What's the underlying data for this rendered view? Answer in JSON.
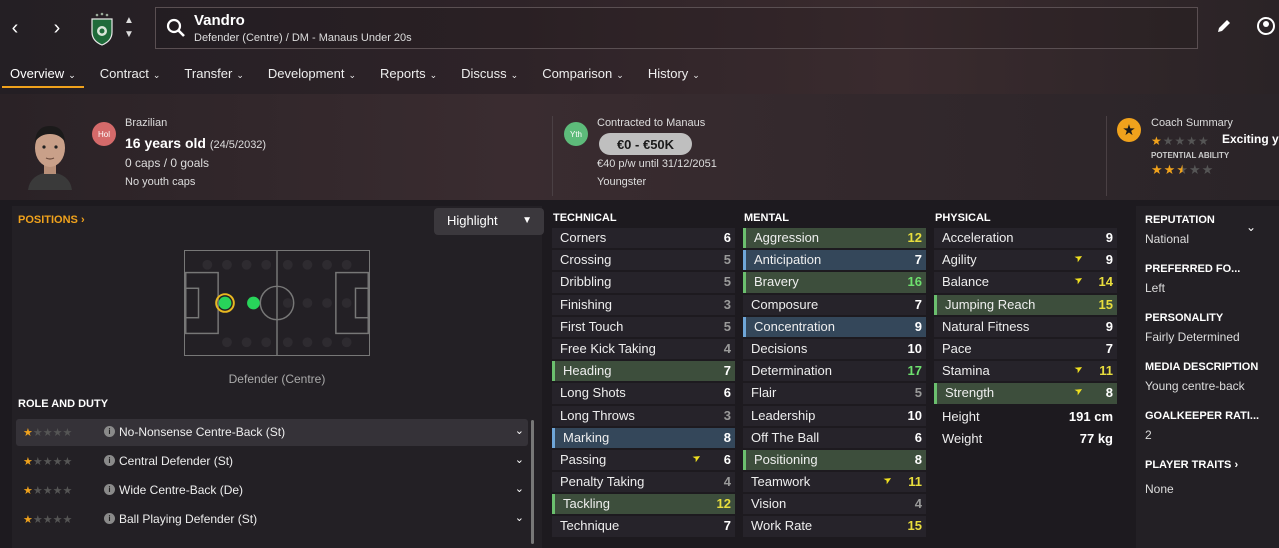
{
  "player": {
    "name": "Vandro",
    "role_club": "Defender (Centre) / DM - Manaus Under 20s",
    "nation_badge": "Hol",
    "nationality": "Brazilian",
    "age": "16 years old",
    "dob": "(24/5/2032)",
    "caps_goals": "0 caps / 0 goals",
    "youth_caps": "No youth caps"
  },
  "tabs": [
    {
      "label": "Overview"
    },
    {
      "label": "Contract"
    },
    {
      "label": "Transfer"
    },
    {
      "label": "Development"
    },
    {
      "label": "Reports"
    },
    {
      "label": "Discuss"
    },
    {
      "label": "Comparison"
    },
    {
      "label": "History"
    }
  ],
  "contract": {
    "badge": "Yth",
    "title": "Contracted to Manaus",
    "value": "€0 - €50K",
    "wage": "€40 p/w until 31/12/2051",
    "type": "Youngster"
  },
  "coach": {
    "title": "Coach Summary",
    "text": "Exciting y",
    "current_stars": 1,
    "potential_label": "POTENTIAL ABILITY",
    "potential_stars": 2.5
  },
  "positions": {
    "link": "POSITIONS",
    "highlight": "Highlight",
    "label": "Defender (Centre)"
  },
  "roles": {
    "title": "ROLE AND DUTY",
    "items": [
      {
        "name": "No-Nonsense Centre-Back (St)",
        "stars": 1
      },
      {
        "name": "Central Defender (St)",
        "stars": 1
      },
      {
        "name": "Wide Centre-Back (De)",
        "stars": 1
      },
      {
        "name": "Ball Playing Defender (St)",
        "stars": 1
      }
    ]
  },
  "technical": {
    "title": "TECHNICAL",
    "attrs": [
      {
        "name": "Corners",
        "value": "6",
        "c": "w"
      },
      {
        "name": "Crossing",
        "value": "5",
        "c": "g"
      },
      {
        "name": "Dribbling",
        "value": "5",
        "c": "g"
      },
      {
        "name": "Finishing",
        "value": "3",
        "c": "g"
      },
      {
        "name": "First Touch",
        "value": "5",
        "c": "g"
      },
      {
        "name": "Free Kick Taking",
        "value": "4",
        "c": "g"
      },
      {
        "name": "Heading",
        "value": "7",
        "c": "w",
        "hl": "hg"
      },
      {
        "name": "Long Shots",
        "value": "6",
        "c": "w"
      },
      {
        "name": "Long Throws",
        "value": "3",
        "c": "g"
      },
      {
        "name": "Marking",
        "value": "8",
        "c": "w",
        "hl": "hb"
      },
      {
        "name": "Passing",
        "value": "6",
        "c": "w",
        "arrow": true
      },
      {
        "name": "Penalty Taking",
        "value": "4",
        "c": "g"
      },
      {
        "name": "Tackling",
        "value": "12",
        "c": "y",
        "hl": "hg"
      },
      {
        "name": "Technique",
        "value": "7",
        "c": "w"
      }
    ]
  },
  "mental": {
    "title": "MENTAL",
    "attrs": [
      {
        "name": "Aggression",
        "value": "12",
        "c": "y",
        "hl": "hg"
      },
      {
        "name": "Anticipation",
        "value": "7",
        "c": "w",
        "hl": "hb"
      },
      {
        "name": "Bravery",
        "value": "16",
        "c": "lg",
        "hl": "hg"
      },
      {
        "name": "Composure",
        "value": "7",
        "c": "w"
      },
      {
        "name": "Concentration",
        "value": "9",
        "c": "w",
        "hl": "hb"
      },
      {
        "name": "Decisions",
        "value": "10",
        "c": "w"
      },
      {
        "name": "Determination",
        "value": "17",
        "c": "lg"
      },
      {
        "name": "Flair",
        "value": "5",
        "c": "g"
      },
      {
        "name": "Leadership",
        "value": "10",
        "c": "w"
      },
      {
        "name": "Off The Ball",
        "value": "6",
        "c": "w"
      },
      {
        "name": "Positioning",
        "value": "8",
        "c": "w",
        "hl": "hg"
      },
      {
        "name": "Teamwork",
        "value": "11",
        "c": "y",
        "arrow": true
      },
      {
        "name": "Vision",
        "value": "4",
        "c": "g"
      },
      {
        "name": "Work Rate",
        "value": "15",
        "c": "y"
      }
    ]
  },
  "physical": {
    "title": "PHYSICAL",
    "attrs": [
      {
        "name": "Acceleration",
        "value": "9",
        "c": "w"
      },
      {
        "name": "Agility",
        "value": "9",
        "c": "w",
        "arrow": true
      },
      {
        "name": "Balance",
        "value": "14",
        "c": "y",
        "arrow": true
      },
      {
        "name": "Jumping Reach",
        "value": "15",
        "c": "y",
        "hl": "hg"
      },
      {
        "name": "Natural Fitness",
        "value": "9",
        "c": "w"
      },
      {
        "name": "Pace",
        "value": "7",
        "c": "w"
      },
      {
        "name": "Stamina",
        "value": "11",
        "c": "y",
        "arrow": true
      },
      {
        "name": "Strength",
        "value": "8",
        "c": "w",
        "hl": "hg",
        "arrow": true
      }
    ],
    "height_label": "Height",
    "height": "191 cm",
    "weight_label": "Weight",
    "weight": "77 kg"
  },
  "info": [
    {
      "title": "REPUTATION",
      "value": "National"
    },
    {
      "title": "PREFERRED FO...",
      "value": "Left"
    },
    {
      "title": "PERSONALITY",
      "value": "Fairly Determined"
    },
    {
      "title": "MEDIA DESCRIPTION",
      "value": "Young centre-back"
    },
    {
      "title": "GOALKEEPER RATI...",
      "value": "2"
    },
    {
      "title": "PLAYER TRAITS",
      "value": "None"
    }
  ],
  "colors": {
    "accent": "#f0a21c",
    "highlight_green": "#3d4e3c",
    "highlight_blue": "#34475a"
  }
}
